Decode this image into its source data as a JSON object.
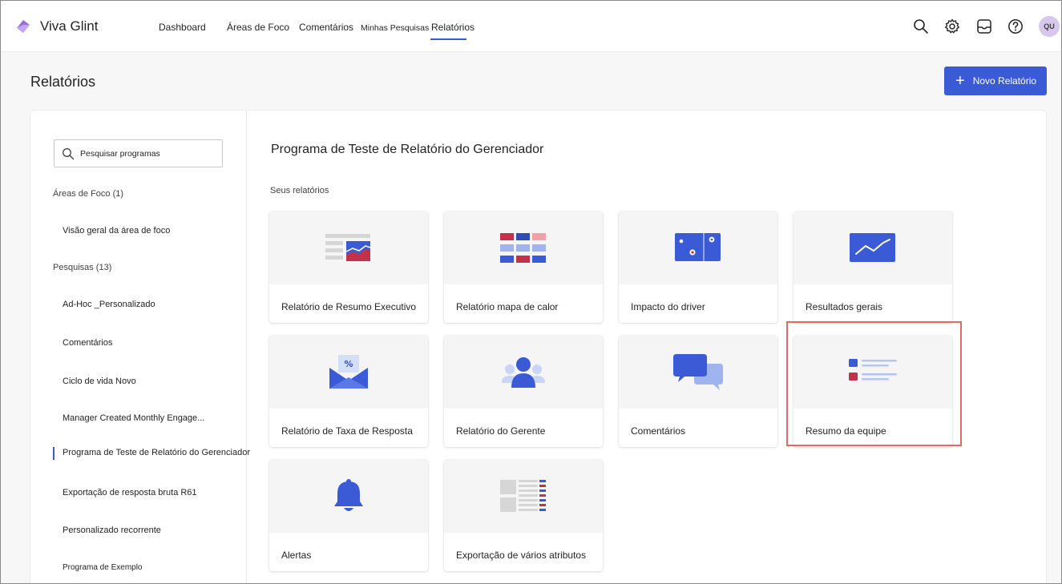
{
  "app": {
    "title": "Viva Glint",
    "avatar_initials": "QU"
  },
  "nav": {
    "items": [
      {
        "label": "Dashboard"
      },
      {
        "label": "Áreas de Foco"
      },
      {
        "label": "Comentários"
      },
      {
        "label": "Minhas Pesquisas"
      },
      {
        "label": "Relatórios"
      }
    ],
    "active": "Relatórios"
  },
  "header_icons": [
    "search-icon",
    "gear-icon",
    "inbox-icon",
    "help-icon"
  ],
  "page": {
    "title": "Relatórios",
    "new_report_label": "Novo Relatório"
  },
  "sidebar": {
    "search_placeholder": "Pesquisar programas",
    "sections": [
      {
        "label": "Áreas de Foco (1)",
        "items": [
          {
            "label": "Visão geral da área de foco"
          }
        ]
      },
      {
        "label": "Pesquisas (13)",
        "items": [
          {
            "label": "Ad-Hoc _Personalizado"
          },
          {
            "label": "Comentários"
          },
          {
            "label": "Ciclo de vida Novo"
          },
          {
            "label": "Manager Created Monthly Engage..."
          },
          {
            "label": "Programa de Teste de Relatório do Gerenciador",
            "active": true
          },
          {
            "label": "Exportação de resposta bruta R61"
          },
          {
            "label": "Personalizado recorrente"
          },
          {
            "label": "Programa de Exemplo"
          }
        ]
      }
    ]
  },
  "content": {
    "title": "Programa de Teste de Relatório do Gerenciador",
    "subtitle": "Seus relatórios",
    "cards": [
      {
        "label": "Relatório de Resumo Executivo",
        "icon": "executive-summary-icon"
      },
      {
        "label": "Relatório mapa de calor",
        "icon": "heatmap-icon"
      },
      {
        "label": "Impacto do driver",
        "icon": "driver-impact-icon"
      },
      {
        "label": "Resultados gerais",
        "icon": "trend-chart-icon"
      },
      {
        "label": "Relatório de Taxa de Resposta",
        "icon": "envelope-percent-icon"
      },
      {
        "label": "Relatório do Gerente",
        "icon": "people-group-icon"
      },
      {
        "label": "Comentários",
        "icon": "chat-bubbles-icon"
      },
      {
        "label": "Resumo da equipe",
        "icon": "team-summary-icon",
        "highlighted": true
      },
      {
        "label": "Alertas",
        "icon": "bell-icon"
      },
      {
        "label": "Exportação de vários atributos",
        "icon": "multi-attribute-export-icon"
      }
    ]
  },
  "colors": {
    "accent": "#3b5bd6",
    "highlight": "#e66a5a",
    "alert_red": "#c4314b"
  }
}
